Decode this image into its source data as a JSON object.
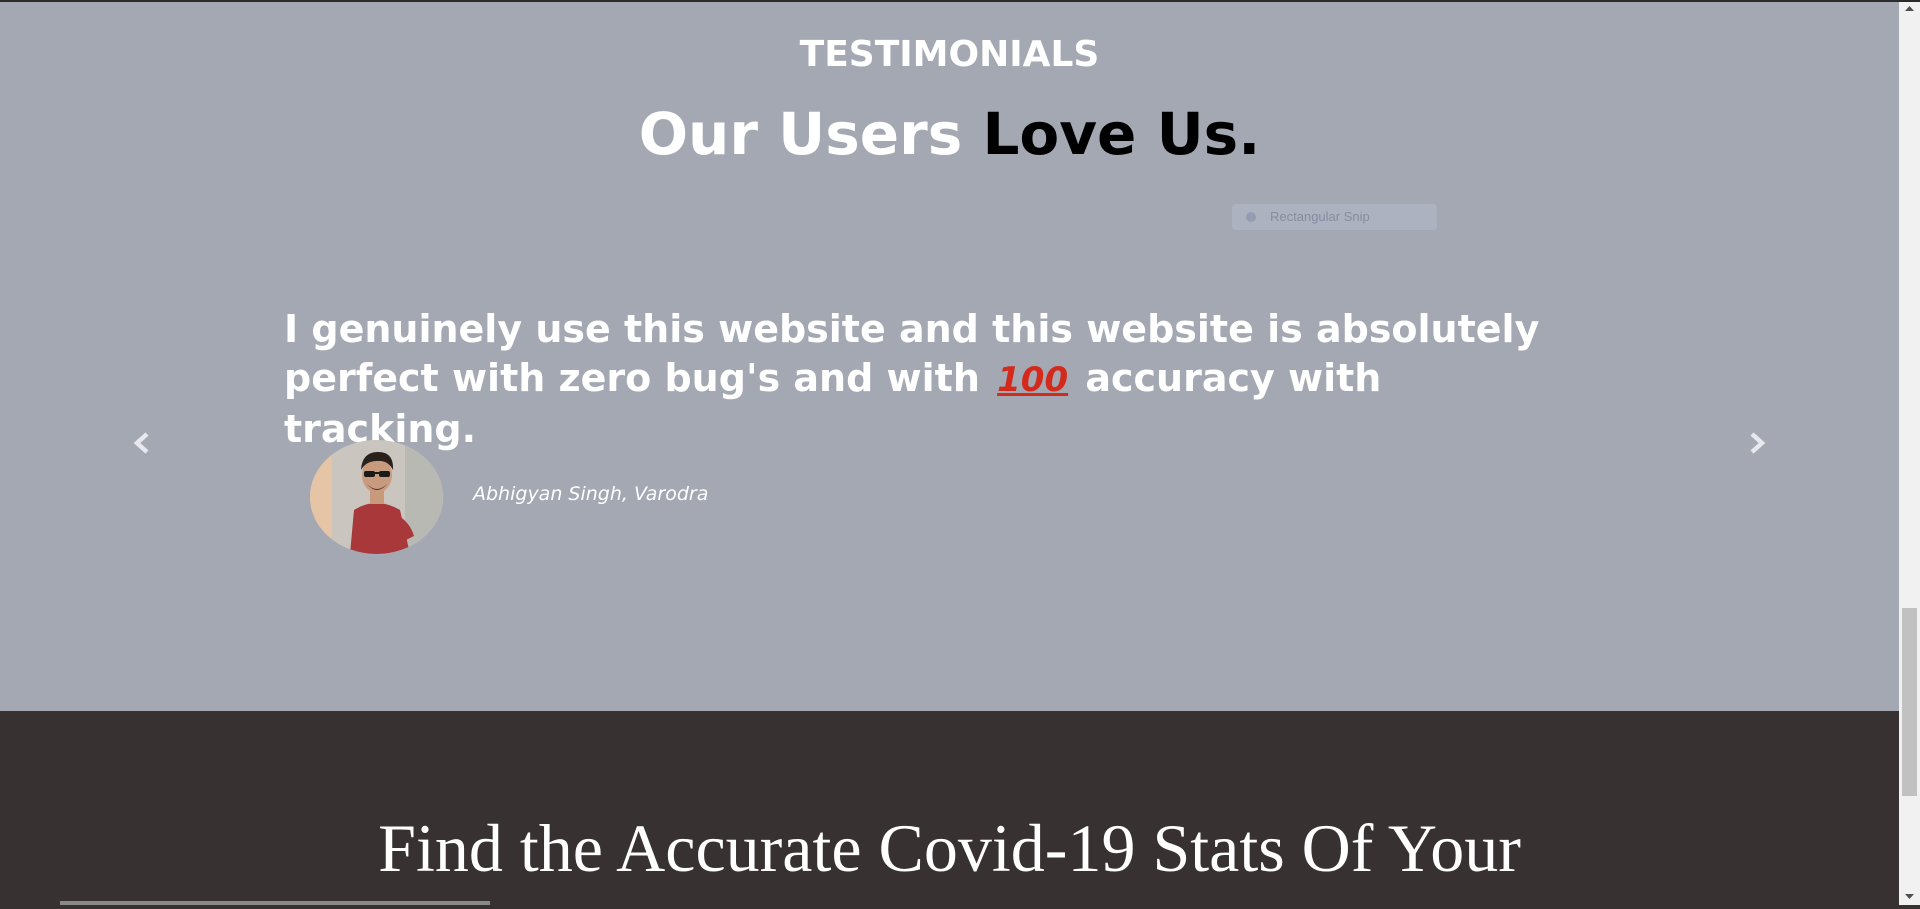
{
  "testimonials": {
    "eyebrow": "TESTIMONIALS",
    "headline_light": "Our Users",
    "headline_dark": "Love Us.",
    "quote_part1": "I genuinely use this website and this website is absolutely perfect with zero bug's and with",
    "quote_emoji": "100",
    "quote_part2": "accuracy with tracking.",
    "author": "Abhigyan Singh, Varodra",
    "prev_icon": "chevron-left-icon",
    "next_icon": "chevron-right-icon",
    "overlay_text": "Rectangular Snip"
  },
  "find": {
    "title": "Find the Accurate Covid-19 Stats Of Your"
  },
  "colors": {
    "testimonials_bg": "#a4a8b3",
    "dark_bg": "#383132",
    "text_light": "#ffffff",
    "text_dark": "#000000",
    "emoji_red": "#d42a1c"
  }
}
